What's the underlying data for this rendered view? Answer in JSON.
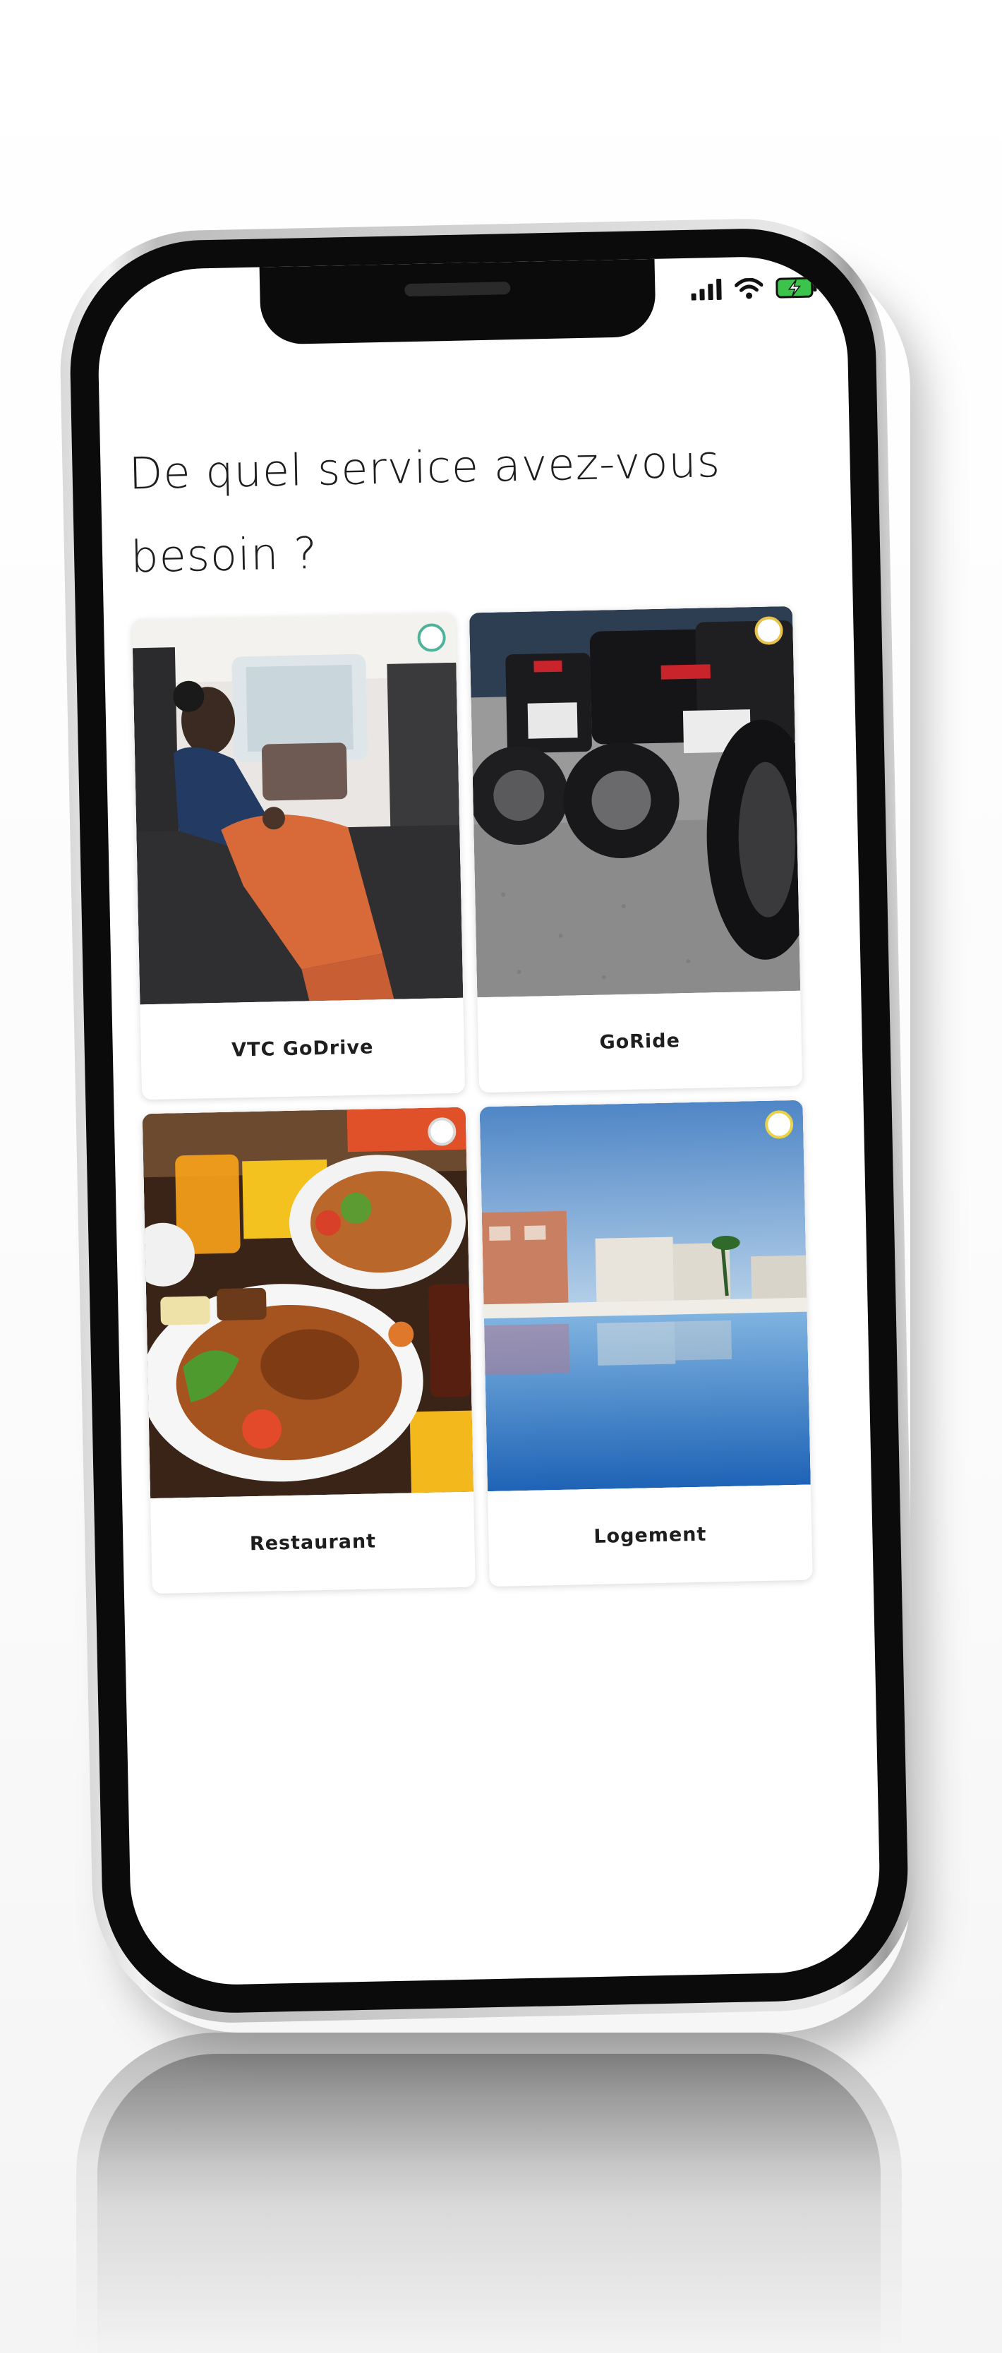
{
  "status_bar": {
    "signal_icon": "cellular-signal-icon",
    "wifi_icon": "wifi-icon",
    "battery_icon": "battery-charging-icon",
    "battery_color": "#3cc34b"
  },
  "page": {
    "title": "De quel service avez-vous besoin ?"
  },
  "services": [
    {
      "label": "VTC GoDrive",
      "image": "woman-in-car-backseat-photo",
      "radio_color": "#4fb39a"
    },
    {
      "label": "GoRide",
      "image": "parked-motorcycles-photo",
      "radio_color": "#e8c24a"
    },
    {
      "label": "Restaurant",
      "image": "grilled-chicken-meal-photo",
      "radio_color": "#d9d9d9"
    },
    {
      "label": "Logement",
      "image": "resort-pool-photo",
      "radio_color": "#e8d24a"
    }
  ]
}
